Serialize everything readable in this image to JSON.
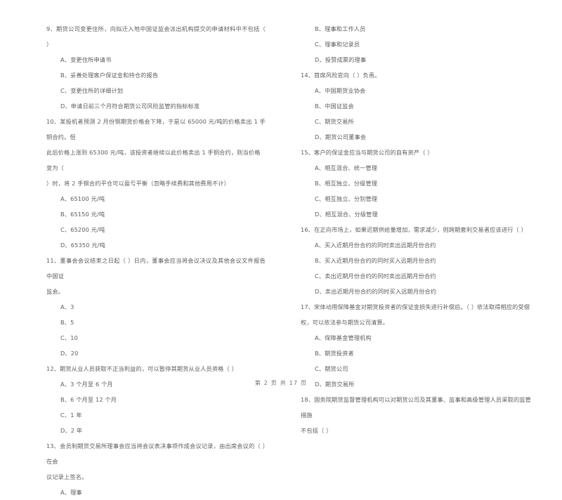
{
  "document": {
    "type": "exam-paper",
    "language": "zh-CN",
    "footer": "第 2 页 共 17 页"
  },
  "left_column": {
    "items": [
      {
        "kind": "stem",
        "text": "9、期货公司变更住所，向拟迁入地中国证监会派出机构提交的申请材料中不包括（      ）"
      },
      {
        "kind": "option",
        "text": "A、变更住所申请书"
      },
      {
        "kind": "option",
        "text": "B、妥善处理客户保证金和持仓的报告"
      },
      {
        "kind": "option",
        "text": "C、变更住所的详细计划"
      },
      {
        "kind": "option",
        "text": "D、申请日前三个月符合期货公司风险监管的指标标准"
      },
      {
        "kind": "stem",
        "text": "10、某投机者预测 2 月份铜期货价格会下降，于是以 65000 元/吨的价格卖出 1 手铜合约。但"
      },
      {
        "kind": "stem-cont",
        "text": "此后价格上涨到 65300 元/吨，该投资者继续以此价格卖出 1 手铜合约，则当价格变为（"
      },
      {
        "kind": "stem-cont",
        "text": "）时，将 2 手铜合约平仓可以盈亏平衡（忽略手续费和其他费用不计）"
      },
      {
        "kind": "option",
        "text": "A、65100 元/吨"
      },
      {
        "kind": "option",
        "text": "B、65150 元/吨"
      },
      {
        "kind": "option",
        "text": "C、65200 元/吨"
      },
      {
        "kind": "option",
        "text": "D、65350 元/吨"
      },
      {
        "kind": "stem",
        "text": "11、董事会会议结束之日起（      ）日内，董事会应当将会议决议及其他会议文件报告中国证"
      },
      {
        "kind": "stem-cont",
        "text": "监会。"
      },
      {
        "kind": "option",
        "text": "A、3"
      },
      {
        "kind": "option",
        "text": "B、5"
      },
      {
        "kind": "option",
        "text": "C、10"
      },
      {
        "kind": "option",
        "text": "D、20"
      },
      {
        "kind": "stem",
        "text": "12、期货从业人员获取不正当利益的，可以暂停其期货从业人员资格（      ）"
      },
      {
        "kind": "option",
        "text": "A、3 个月至 6 个月"
      },
      {
        "kind": "option",
        "text": "B、6 个月至 12 个月"
      },
      {
        "kind": "option",
        "text": "C、1 年"
      },
      {
        "kind": "option",
        "text": "D、2 年"
      },
      {
        "kind": "stem",
        "text": "13、会员制期货交易所理事会应当将会议表决事项作成会议记录，由出席会议的（      ）在会"
      },
      {
        "kind": "stem-cont",
        "text": "议记录上签名。"
      },
      {
        "kind": "option",
        "text": "A、理事"
      }
    ]
  },
  "right_column": {
    "items": [
      {
        "kind": "option",
        "text": "B、理事和工作人员"
      },
      {
        "kind": "option",
        "text": "C、理事和记录员"
      },
      {
        "kind": "option",
        "text": "D、投赞成票的理事"
      },
      {
        "kind": "stem",
        "text": "14、首席风险官向（      ）负责。"
      },
      {
        "kind": "option",
        "text": "A、中国期货业协会"
      },
      {
        "kind": "option",
        "text": "B、中国证监会"
      },
      {
        "kind": "option",
        "text": "C、期货交易所"
      },
      {
        "kind": "option",
        "text": "D、期货公司董事会"
      },
      {
        "kind": "stem",
        "text": "15、客户的保证金应当与期货公司的自有资产（      ）"
      },
      {
        "kind": "option",
        "text": "A、相互混合、统一管理"
      },
      {
        "kind": "option",
        "text": "B、相互独立、分级管理"
      },
      {
        "kind": "option",
        "text": "C、相互独立、分别管理"
      },
      {
        "kind": "option",
        "text": "D、相互混合、分级管理"
      },
      {
        "kind": "stem",
        "text": "16、在正向市场上，如果近期供给量增加，需求减少，则跨期套利交易者应该进行（      ）"
      },
      {
        "kind": "option",
        "text": "A、买入近期月份合约的同时卖出远期月份合约"
      },
      {
        "kind": "option",
        "text": "B、买入近期月份合约的同时买入远期月份合约"
      },
      {
        "kind": "option",
        "text": "C、卖出近期月份合约的同时卖出远期月份合约"
      },
      {
        "kind": "option",
        "text": "D、卖出近期月份合约的同时买入远期月份合约"
      },
      {
        "kind": "stem",
        "text": "17、宋体动用保障基金对期货投资者的保证金损失进行补偿后。（      ）依法取得相应的受偿"
      },
      {
        "kind": "stem-cont",
        "text": "权，可以依法参与期货公司清算。"
      },
      {
        "kind": "option",
        "text": "A、保障基金管理机构"
      },
      {
        "kind": "option",
        "text": "B、期货投资者"
      },
      {
        "kind": "option",
        "text": "C、期货公司"
      },
      {
        "kind": "option",
        "text": "D、期货交易所"
      },
      {
        "kind": "stem",
        "text": "18、国务院期货监督管理机构可以对期货公司及其董事、监事和高级管理人员采取的监管措施"
      },
      {
        "kind": "stem-cont",
        "text": "不包括（      ）"
      }
    ]
  }
}
